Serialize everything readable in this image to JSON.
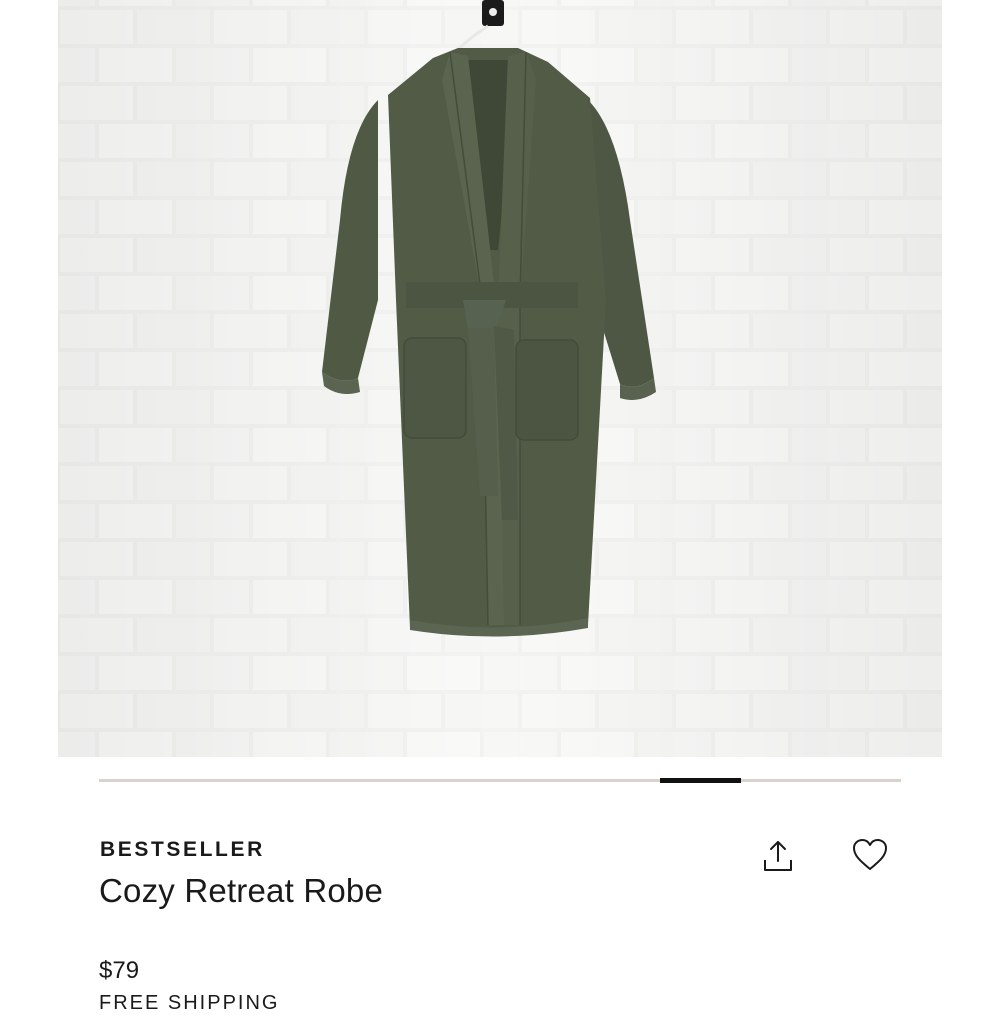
{
  "product": {
    "image_alt": "Olive green robe hanging on a white brick wall",
    "badge": "BESTSELLER",
    "title": "Cozy Retreat Robe",
    "price": "$79",
    "shipping": "FREE SHIPPING"
  },
  "carousel": {
    "slide_count": 10,
    "active_slide": 8
  },
  "actions": {
    "share_icon": "share-icon",
    "favorite_icon": "heart-icon"
  },
  "colors": {
    "robe": "#505a45",
    "wall": "#f1f1ef",
    "track": "#d9d3cb",
    "thumb": "#111111"
  }
}
